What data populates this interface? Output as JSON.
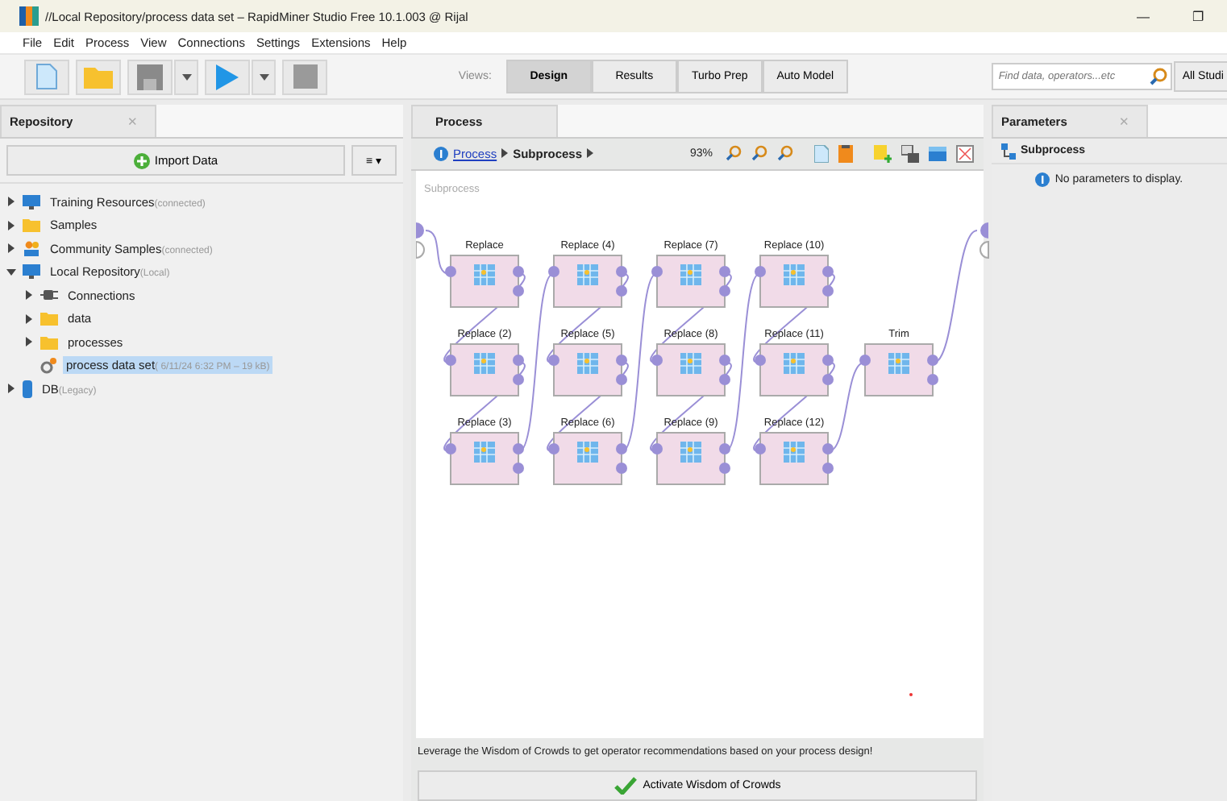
{
  "window": {
    "title": "//Local Repository/process data set – RapidMiner Studio Free 10.1.003 @ Rijal",
    "controls": [
      "—",
      "❐"
    ]
  },
  "menu": [
    "File",
    "Edit",
    "Process",
    "View",
    "Connections",
    "Settings",
    "Extensions",
    "Help"
  ],
  "toolbar": [
    {
      "kind": "new"
    },
    {
      "kind": "open"
    },
    {
      "kind": "save"
    },
    {
      "kind": "dropdown"
    },
    {
      "kind": "run"
    },
    {
      "kind": "dropdown"
    },
    {
      "kind": "stop"
    }
  ],
  "views": {
    "label": "Views:",
    "items": [
      {
        "label": "Design",
        "selected": true
      },
      {
        "label": "Results",
        "selected": false
      },
      {
        "label": "Turbo Prep",
        "selected": false
      },
      {
        "label": "Auto Model",
        "selected": false
      }
    ]
  },
  "search": {
    "placeholder": "Find data, operators...etc",
    "scope": "All Studi"
  },
  "repository": {
    "tab": "Repository",
    "close": "✕",
    "import_button": "Import Data",
    "menu_button": "≡ ▾",
    "tree": [
      {
        "label": "Training Resources",
        "note": "(connected)",
        "kind": "monitor",
        "expanded": false,
        "selected": false
      },
      {
        "label": "Samples",
        "kind": "folder",
        "expanded": false,
        "selected": false
      },
      {
        "label": "Community Samples",
        "note": "(connected)",
        "kind": "people",
        "expanded": false,
        "selected": false
      },
      {
        "label": "Local Repository",
        "note": "(Local)",
        "kind": "monitor",
        "expanded": true,
        "selected": false,
        "children": [
          {
            "label": "Connections",
            "kind": "plug",
            "expanded": false,
            "selected": false
          },
          {
            "label": "data",
            "kind": "folder",
            "expanded": false,
            "selected": false
          },
          {
            "label": "processes",
            "kind": "folder",
            "expanded": false,
            "selected": false
          },
          {
            "label": "process data set",
            "note": "( 6/11/24 6:32 PM – 19 kB)",
            "kind": "process",
            "selected": true
          }
        ]
      },
      {
        "label": "DB",
        "note": "(Legacy)",
        "kind": "db",
        "expanded": false,
        "selected": false
      }
    ]
  },
  "process": {
    "tab": "Process",
    "breadcrumb": [
      "Process",
      "Subprocess"
    ],
    "zoom": "93%",
    "canvas_label": "Subprocess",
    "operator_columns": [
      [
        {
          "name": "Replace"
        },
        {
          "name": "Replace (2)"
        },
        {
          "name": "Replace (3)"
        }
      ],
      [
        {
          "name": "Replace (4)"
        },
        {
          "name": "Replace (5)"
        },
        {
          "name": "Replace (6)"
        }
      ],
      [
        {
          "name": "Replace (7)"
        },
        {
          "name": "Replace (8)"
        },
        {
          "name": "Replace (9)"
        }
      ],
      [
        {
          "name": "Replace (10)"
        },
        {
          "name": "Replace (11)"
        },
        {
          "name": "Replace (12)"
        }
      ],
      [
        {
          "name": "Trim"
        }
      ]
    ],
    "hint": "Leverage the Wisdom of Crowds to get operator recommendations based on your process design!",
    "button": "Activate Wisdom of Crowds"
  },
  "parameters": {
    "tab": "Parameters",
    "close": "✕",
    "header": "Subprocess",
    "message": "No parameters to display."
  }
}
